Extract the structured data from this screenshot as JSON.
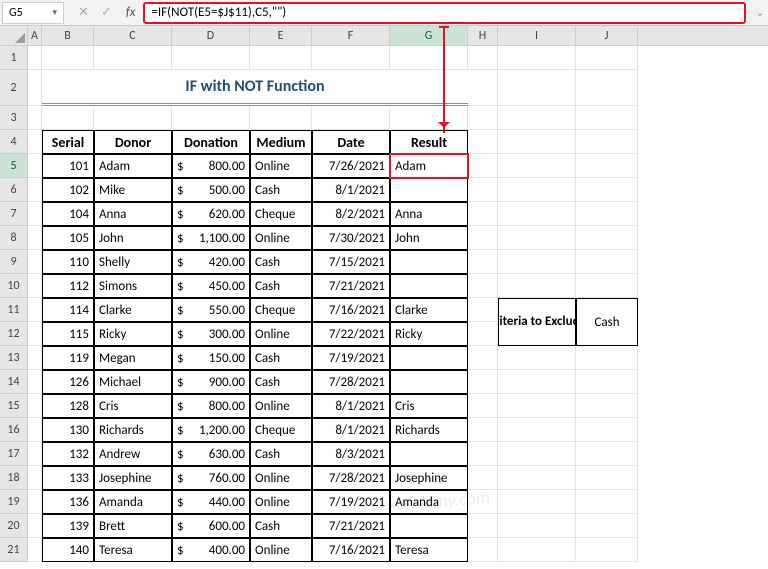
{
  "nameBox": "G5",
  "formula": "=IF(NOT(E5=$J$11),C5,\"\")",
  "columns": [
    "A",
    "B",
    "C",
    "D",
    "E",
    "F",
    "G",
    "H",
    "I",
    "J"
  ],
  "activeCol": "G",
  "activeRow": 5,
  "title": "IF with NOT Function",
  "headers": {
    "serial": "Serial",
    "donor": "Donor",
    "donation": "Donation",
    "medium": "Medium",
    "date": "Date",
    "result": "Result"
  },
  "rows": [
    {
      "n": 5,
      "serial": "101",
      "donor": "Adam",
      "donation": "800.00",
      "medium": "Online",
      "date": "7/26/2021",
      "result": "Adam"
    },
    {
      "n": 6,
      "serial": "102",
      "donor": "Mike",
      "donation": "500.00",
      "medium": "Cash",
      "date": "8/1/2021",
      "result": ""
    },
    {
      "n": 7,
      "serial": "104",
      "donor": "Anna",
      "donation": "620.00",
      "medium": "Cheque",
      "date": "8/2/2021",
      "result": "Anna"
    },
    {
      "n": 8,
      "serial": "105",
      "donor": "John",
      "donation": "1,100.00",
      "medium": "Online",
      "date": "7/30/2021",
      "result": "John"
    },
    {
      "n": 9,
      "serial": "110",
      "donor": "Shelly",
      "donation": "420.00",
      "medium": "Cash",
      "date": "7/15/2021",
      "result": ""
    },
    {
      "n": 10,
      "serial": "112",
      "donor": "Simons",
      "donation": "450.00",
      "medium": "Cash",
      "date": "7/21/2021",
      "result": ""
    },
    {
      "n": 11,
      "serial": "114",
      "donor": "Clarke",
      "donation": "550.00",
      "medium": "Cheque",
      "date": "7/16/2021",
      "result": "Clarke"
    },
    {
      "n": 12,
      "serial": "115",
      "donor": "Ricky",
      "donation": "300.00",
      "medium": "Online",
      "date": "7/22/2021",
      "result": "Ricky"
    },
    {
      "n": 13,
      "serial": "119",
      "donor": "Megan",
      "donation": "150.00",
      "medium": "Cash",
      "date": "7/19/2021",
      "result": ""
    },
    {
      "n": 14,
      "serial": "126",
      "donor": "Michael",
      "donation": "900.00",
      "medium": "Cash",
      "date": "7/28/2021",
      "result": ""
    },
    {
      "n": 15,
      "serial": "128",
      "donor": "Cris",
      "donation": "800.00",
      "medium": "Online",
      "date": "8/1/2021",
      "result": "Cris"
    },
    {
      "n": 16,
      "serial": "130",
      "donor": "Richards",
      "donation": "1,200.00",
      "medium": "Cheque",
      "date": "8/1/2021",
      "result": "Richards"
    },
    {
      "n": 17,
      "serial": "132",
      "donor": "Andrew",
      "donation": "630.00",
      "medium": "Cash",
      "date": "8/3/2021",
      "result": ""
    },
    {
      "n": 18,
      "serial": "133",
      "donor": "Josephine",
      "donation": "760.00",
      "medium": "Online",
      "date": "7/28/2021",
      "result": "Josephine"
    },
    {
      "n": 19,
      "serial": "136",
      "donor": "Amanda",
      "donation": "440.00",
      "medium": "Online",
      "date": "7/19/2021",
      "result": "Amanda"
    },
    {
      "n": 20,
      "serial": "139",
      "donor": "Brett",
      "donation": "600.00",
      "medium": "Cash",
      "date": "7/21/2021",
      "result": ""
    },
    {
      "n": 21,
      "serial": "140",
      "donor": "Teresa",
      "donation": "400.00",
      "medium": "Online",
      "date": "7/16/2021",
      "result": "Teresa"
    }
  ],
  "criteria": {
    "label": "Criteria to Exclude",
    "value": "Cash"
  },
  "currency": "$",
  "watermark": "exceldemy.com"
}
